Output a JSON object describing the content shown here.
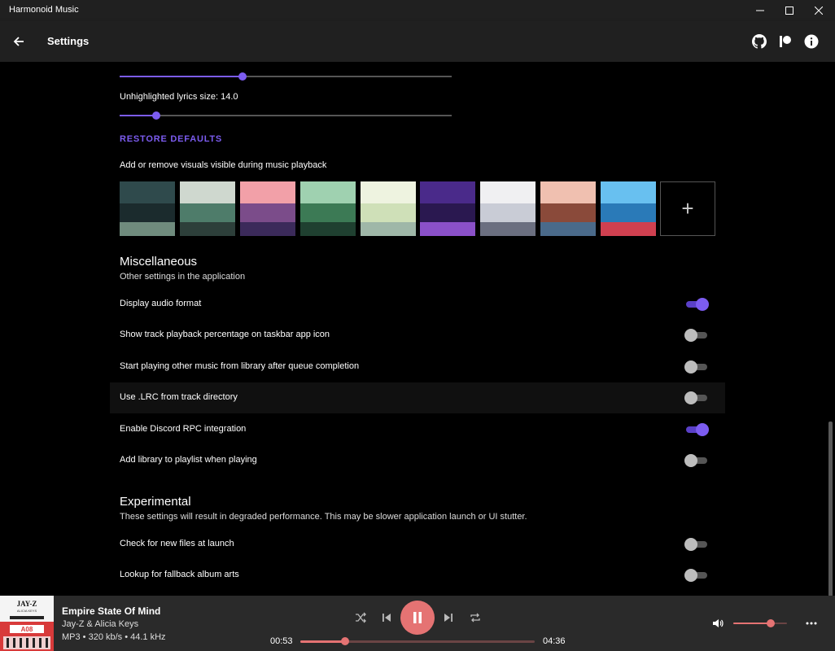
{
  "window": {
    "title": "Harmonoid Music"
  },
  "header": {
    "title": "Settings"
  },
  "lyrics": {
    "unhighlighted_label": "Unhighlighted lyrics size: 14.0",
    "highlighted_slider_fraction": 0.37,
    "unhighlighted_slider_fraction": 0.11,
    "restore_defaults": "RESTORE DEFAULTS"
  },
  "visuals": {
    "label": "Add or remove visuals visible during music playback",
    "add_symbol": "+",
    "thumbnails": [
      {
        "name": "visual-1",
        "colors": [
          "#2f4a4c",
          "#1b2b2d",
          "#6f8b7d"
        ]
      },
      {
        "name": "visual-2",
        "colors": [
          "#cfd8cf",
          "#4e7c6a",
          "#2d3f3a"
        ]
      },
      {
        "name": "visual-3",
        "colors": [
          "#f2a0a8",
          "#7b4c8a",
          "#3b2a5a"
        ]
      },
      {
        "name": "visual-4",
        "colors": [
          "#9fd1b0",
          "#3c7a55",
          "#1f4030"
        ]
      },
      {
        "name": "visual-5",
        "colors": [
          "#eef3e0",
          "#cfe0b8",
          "#9fb7a8"
        ]
      },
      {
        "name": "visual-6",
        "colors": [
          "#4a2a8a",
          "#2a1850",
          "#8a50c8"
        ]
      },
      {
        "name": "visual-7",
        "colors": [
          "#f0f0f2",
          "#c9ccd6",
          "#6b6f80"
        ]
      },
      {
        "name": "visual-8",
        "colors": [
          "#f0c0b0",
          "#8a4a3a",
          "#4a6a8a"
        ]
      },
      {
        "name": "visual-9",
        "colors": [
          "#68c0f0",
          "#2a7ab8",
          "#d04050"
        ]
      }
    ]
  },
  "misc": {
    "title": "Miscellaneous",
    "subtitle": "Other settings in the application",
    "settings": [
      {
        "label": "Display audio format",
        "on": true
      },
      {
        "label": "Show track playback percentage on taskbar app icon",
        "on": false
      },
      {
        "label": "Start playing other music from library after queue completion",
        "on": false
      },
      {
        "label": "Use .LRC from track directory",
        "on": false
      },
      {
        "label": "Enable Discord RPC integration",
        "on": true
      },
      {
        "label": "Add library to playlist when playing",
        "on": false
      }
    ]
  },
  "experimental": {
    "title": "Experimental",
    "subtitle": "These settings will result in degraded performance. This may be slower application launch or UI stutter.",
    "settings": [
      {
        "label": "Check for new files at launch",
        "on": false
      },
      {
        "label": "Lookup for fallback album arts",
        "on": false
      }
    ]
  },
  "player": {
    "title": "Empire State Of Mind",
    "artist": "Jay-Z & Alicia Keys",
    "format": "MP3 • 320 kb/s • 44.1 kHz",
    "position": "00:53",
    "duration": "04:36",
    "progress_fraction": 0.19,
    "volume_fraction": 0.7,
    "album_art_text": {
      "artist": "JAY-Z",
      "sub": "ALICIA KEYS",
      "badge": "A08"
    }
  },
  "colors": {
    "accent": "#7c5cf0",
    "player_accent": "#e57373"
  }
}
